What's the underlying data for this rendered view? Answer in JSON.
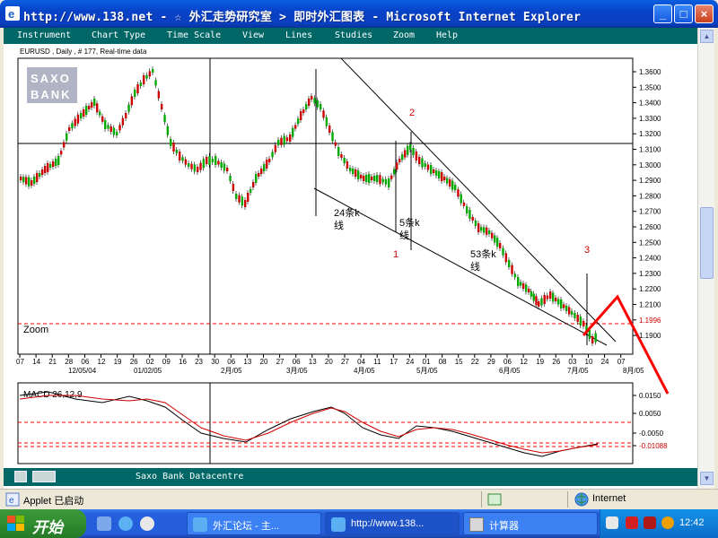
{
  "window": {
    "title": "http://www.138.net - ☆ 外汇走势研究室 > 即时外汇图表 - Microsoft Internet Explorer",
    "buttons": {
      "minimize": "_",
      "maximize": "□",
      "close": "×"
    }
  },
  "menu": {
    "items": [
      "Instrument",
      "Chart Type",
      "Time Scale",
      "View",
      "Lines",
      "Studies",
      "Zoom",
      "Help"
    ]
  },
  "chart": {
    "header": "EURUSD , Daily , # 177, Real-time data",
    "logo_lines": [
      "SAXO",
      "BANK"
    ],
    "zoom_label": "Zoom",
    "price_ticks": [
      "1.3600",
      "1.3500",
      "1.3400",
      "1.3300",
      "1.3200",
      "1.3100",
      "1.3000",
      "1.2900",
      "1.2800",
      "1.2700",
      "1.2600",
      "1.2500",
      "1.2400",
      "1.2300",
      "1.2200",
      "1.2100",
      "1.1996",
      "1.1900"
    ],
    "day_ticks": [
      "07",
      "14",
      "21",
      "28",
      "06",
      "12",
      "19",
      "26",
      "02",
      "09",
      "16",
      "23",
      "30",
      "06",
      "13",
      "20",
      "27",
      "06",
      "13",
      "20",
      "27",
      "04",
      "11",
      "17",
      "24",
      "01",
      "08",
      "15",
      "22",
      "29",
      "06",
      "12",
      "19",
      "26",
      "03",
      "10",
      "24",
      "07"
    ],
    "month_labels": [
      "12/05/04",
      "01/02/05",
      "2月/05",
      "3月/05",
      "4月/05",
      "5月/05",
      "6月/05",
      "7月/05",
      "8月/05"
    ],
    "annotations": {
      "wave1": "1",
      "wave2": "2",
      "wave3": "3",
      "label_24": "24条k",
      "label_24_b": "线",
      "label_5": "5条k",
      "label_5_b": "线",
      "label_53": "53条k",
      "label_53_b": "线"
    },
    "macd_label": "MACD 26,12,9",
    "macd_ticks": [
      "0.0150",
      "0.0050",
      "-0.0050",
      "-0.01088"
    ],
    "colors": {
      "up": "#00aa00",
      "down": "#cc0000",
      "red_line": "#ff0000",
      "macd_black": "#000000",
      "macd_red": "#cc0000"
    }
  },
  "footer": {
    "label": "Saxo Bank Datacentre"
  },
  "status": {
    "left": "Applet 已启动",
    "zone": "Internet"
  },
  "taskbar": {
    "start": "开始",
    "tasks": [
      "外汇论坛 - 主...",
      "http://www.138...",
      "计算器"
    ],
    "clock": "12:42"
  }
}
